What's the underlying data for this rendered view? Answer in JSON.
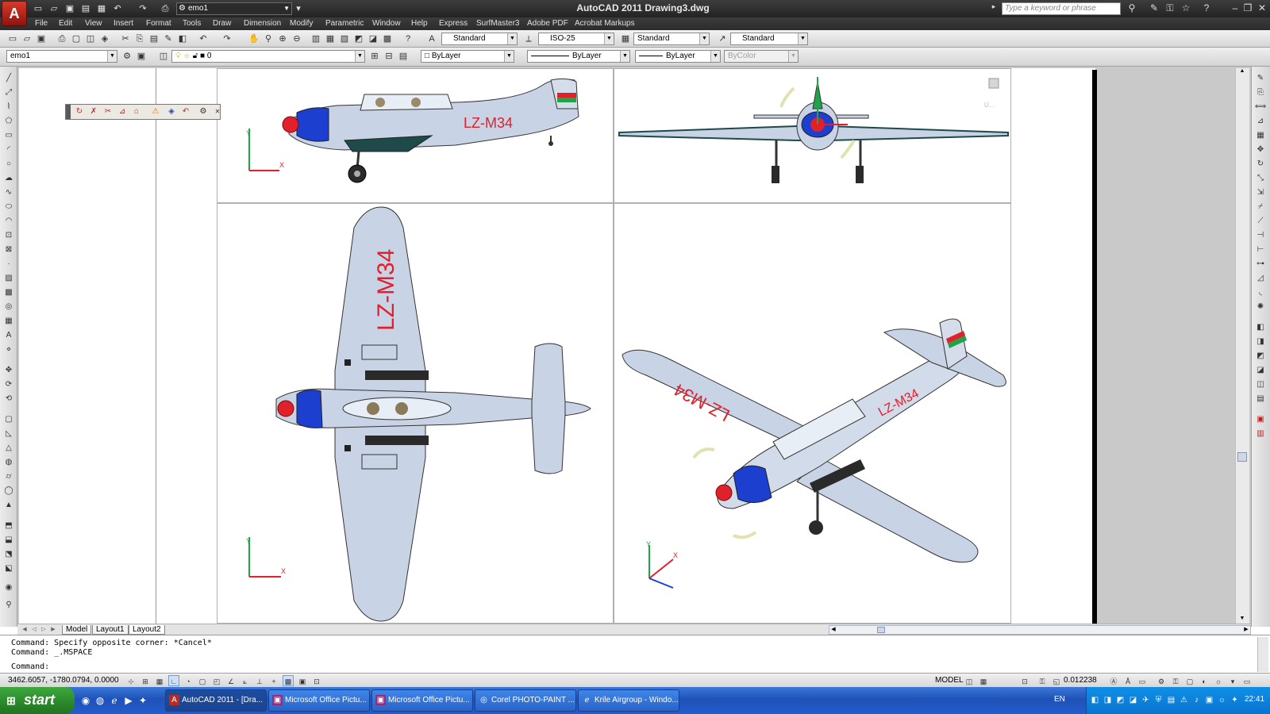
{
  "app": {
    "logo": "A",
    "window_title": "AutoCAD 2011    Drawing3.dwg",
    "workspace": "emo1",
    "search_placeholder": "Type a keyword or phrase"
  },
  "menu": [
    "File",
    "Edit",
    "View",
    "Insert",
    "Format",
    "Tools",
    "Draw",
    "Dimension",
    "Modify",
    "Parametric",
    "Window",
    "Help",
    "Express",
    "SurfMaster3",
    "Adobe PDF",
    "Acrobat Markups"
  ],
  "toolbar1": {
    "text_style": "Standard",
    "dim_style": "ISO-25",
    "table_style": "Standard",
    "mleader_style": "Standard"
  },
  "toolbar2": {
    "workspace": "emo1",
    "layer": "0",
    "color": "ByLayer",
    "linetype": "ByLayer",
    "lineweight": "ByLayer",
    "plotstyle": "ByColor"
  },
  "viewports": {
    "top_right_label": "U...",
    "registration": "LZ-M34",
    "ucs_y": "Y",
    "ucs_x": "X"
  },
  "layout_tabs": [
    "Model",
    "Layout1",
    "Layout2"
  ],
  "active_tab": "Layout2",
  "command": {
    "line1": "Command: Specify opposite corner: *Cancel*",
    "line2": "Command: _.MSPACE",
    "prompt": "Command:"
  },
  "status": {
    "coords": "3462.6057, -1780.0794, 0.0000",
    "space": "MODEL",
    "scale": "0.012238"
  },
  "taskbar": {
    "start": "start",
    "tasks": [
      {
        "label": "AutoCAD 2011 - [Dra...",
        "active": true
      },
      {
        "label": "Microsoft Office Pictu...",
        "active": false
      },
      {
        "label": "Microsoft Office Pictu...",
        "active": false
      },
      {
        "label": "Corel PHOTO-PAINT ...",
        "active": false
      },
      {
        "label": "Krile Airgroup - Windo...",
        "active": false
      }
    ],
    "lang": "EN",
    "clock": "22:41"
  },
  "colors": {
    "fuselage": "#c8d4e6",
    "accent_red": "#e0202a",
    "cowl_blue": "#1c3fd0",
    "dark_panel": "#1f4a4a"
  }
}
